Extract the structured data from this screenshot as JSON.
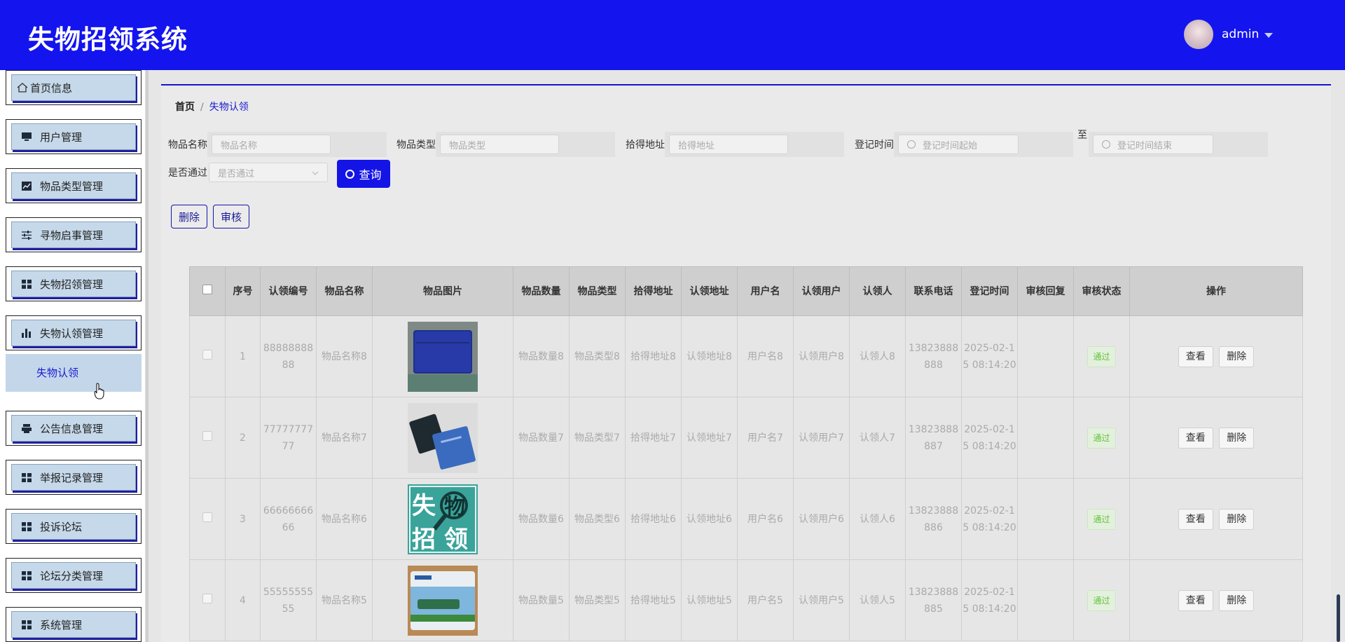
{
  "header": {
    "title": "失物招领系统",
    "username": "admin"
  },
  "sidebar": {
    "items": [
      {
        "label": "首页信息",
        "icon": "home-icon"
      },
      {
        "label": "用户管理",
        "icon": "monitor-icon"
      },
      {
        "label": "物品类型管理",
        "icon": "chart-icon"
      },
      {
        "label": "寻物启事管理",
        "icon": "sliders-icon"
      },
      {
        "label": "失物招领管理",
        "icon": "grid-icon"
      },
      {
        "label": "失物认领管理",
        "icon": "bar-chart-icon"
      },
      {
        "label": "公告信息管理",
        "icon": "printer-icon"
      },
      {
        "label": "举报记录管理",
        "icon": "grid-icon"
      },
      {
        "label": "投诉论坛",
        "icon": "grid-icon"
      },
      {
        "label": "论坛分类管理",
        "icon": "grid-icon"
      },
      {
        "label": "系统管理",
        "icon": "grid-icon"
      }
    ],
    "subitem": "失物认领"
  },
  "breadcrumb": {
    "home": "首页",
    "separator": "/",
    "current": "失物认领"
  },
  "filters": {
    "name_label": "物品名称",
    "name_placeholder": "物品名称",
    "type_label": "物品类型",
    "type_placeholder": "物品类型",
    "addr_label": "拾得地址",
    "addr_placeholder": "拾得地址",
    "time_label": "登记时间",
    "time_start_placeholder": "登记时间起始",
    "to_label": "至",
    "time_end_placeholder": "登记时间结束",
    "pass_label": "是否通过",
    "pass_placeholder": "是否通过",
    "query_button": "查询"
  },
  "actions": {
    "delete": "删除",
    "audit": "审核"
  },
  "table": {
    "headers": [
      "序号",
      "认领编号",
      "物品名称",
      "物品图片",
      "物品数量",
      "物品类型",
      "拾得地址",
      "认领地址",
      "用户名",
      "认领用户",
      "认领人",
      "联系电话",
      "登记时间",
      "审核回复",
      "审核状态",
      "操作"
    ],
    "view_label": "查看",
    "delete_label": "删除",
    "rows": [
      {
        "idx": "1",
        "code": "8888888888",
        "name": "物品名称8",
        "image": "blue-wallet-photo",
        "qty": "物品数量8",
        "type": "物品类型8",
        "found": "拾得地址8",
        "claim": "认领地址8",
        "user": "用户名8",
        "claim_user": "认领用户8",
        "claimer": "认领人8",
        "phone": "13823888888",
        "time": "2025-02-15 08:14:20",
        "reply": "",
        "status": "通过"
      },
      {
        "idx": "2",
        "code": "7777777777",
        "name": "物品名称7",
        "image": "id-cards-photo",
        "qty": "物品数量7",
        "type": "物品类型7",
        "found": "拾得地址7",
        "claim": "认领地址7",
        "user": "用户名7",
        "claim_user": "认领用户7",
        "claimer": "认领人7",
        "phone": "13823888887",
        "time": "2025-02-15 08:14:20",
        "reply": "",
        "status": "通过"
      },
      {
        "idx": "3",
        "code": "6666666666",
        "name": "物品名称6",
        "image": "lost-found-poster",
        "qty": "物品数量6",
        "type": "物品类型6",
        "found": "拾得地址6",
        "claim": "认领地址6",
        "user": "用户名6",
        "claim_user": "认领用户6",
        "claimer": "认领人6",
        "phone": "13823888886",
        "time": "2025-02-15 08:14:20",
        "reply": "",
        "status": "通过"
      },
      {
        "idx": "4",
        "code": "5555555555",
        "name": "物品名称5",
        "image": "bus-card-photo",
        "qty": "物品数量5",
        "type": "物品类型5",
        "found": "拾得地址5",
        "claim": "认领地址5",
        "user": "用户名5",
        "claim_user": "认领用户5",
        "claimer": "认领人5",
        "phone": "13823888885",
        "time": "2025-02-15 08:14:20",
        "reply": "",
        "status": "通过"
      }
    ]
  },
  "colors": {
    "header": "#1414ee",
    "accent": "#1a1ad0",
    "status_green": "#67c23a"
  },
  "poster_text": [
    "失",
    "物",
    "招",
    "领"
  ]
}
